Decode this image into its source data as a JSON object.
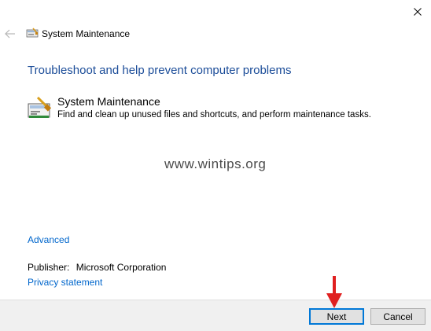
{
  "window": {
    "title": "System Maintenance"
  },
  "heading": "Troubleshoot and help prevent computer problems",
  "item": {
    "title": "System Maintenance",
    "description": "Find and clean up unused files and shortcuts, and perform maintenance tasks."
  },
  "watermark": "www.wintips.org",
  "links": {
    "advanced": "Advanced",
    "privacy": "Privacy statement"
  },
  "publisher": {
    "label": "Publisher:",
    "value": "Microsoft Corporation"
  },
  "buttons": {
    "next": "Next",
    "cancel": "Cancel"
  },
  "icons": {
    "close": "close-icon",
    "back": "back-arrow-icon",
    "title": "system-maintenance-icon",
    "item": "system-maintenance-icon",
    "annotation": "red-arrow-icon"
  },
  "colors": {
    "heading": "#1c4d99",
    "link": "#0066cc",
    "footer_bg": "#f0f0f0",
    "default_button_border": "#0078d7",
    "annotation_arrow": "#e02020"
  }
}
